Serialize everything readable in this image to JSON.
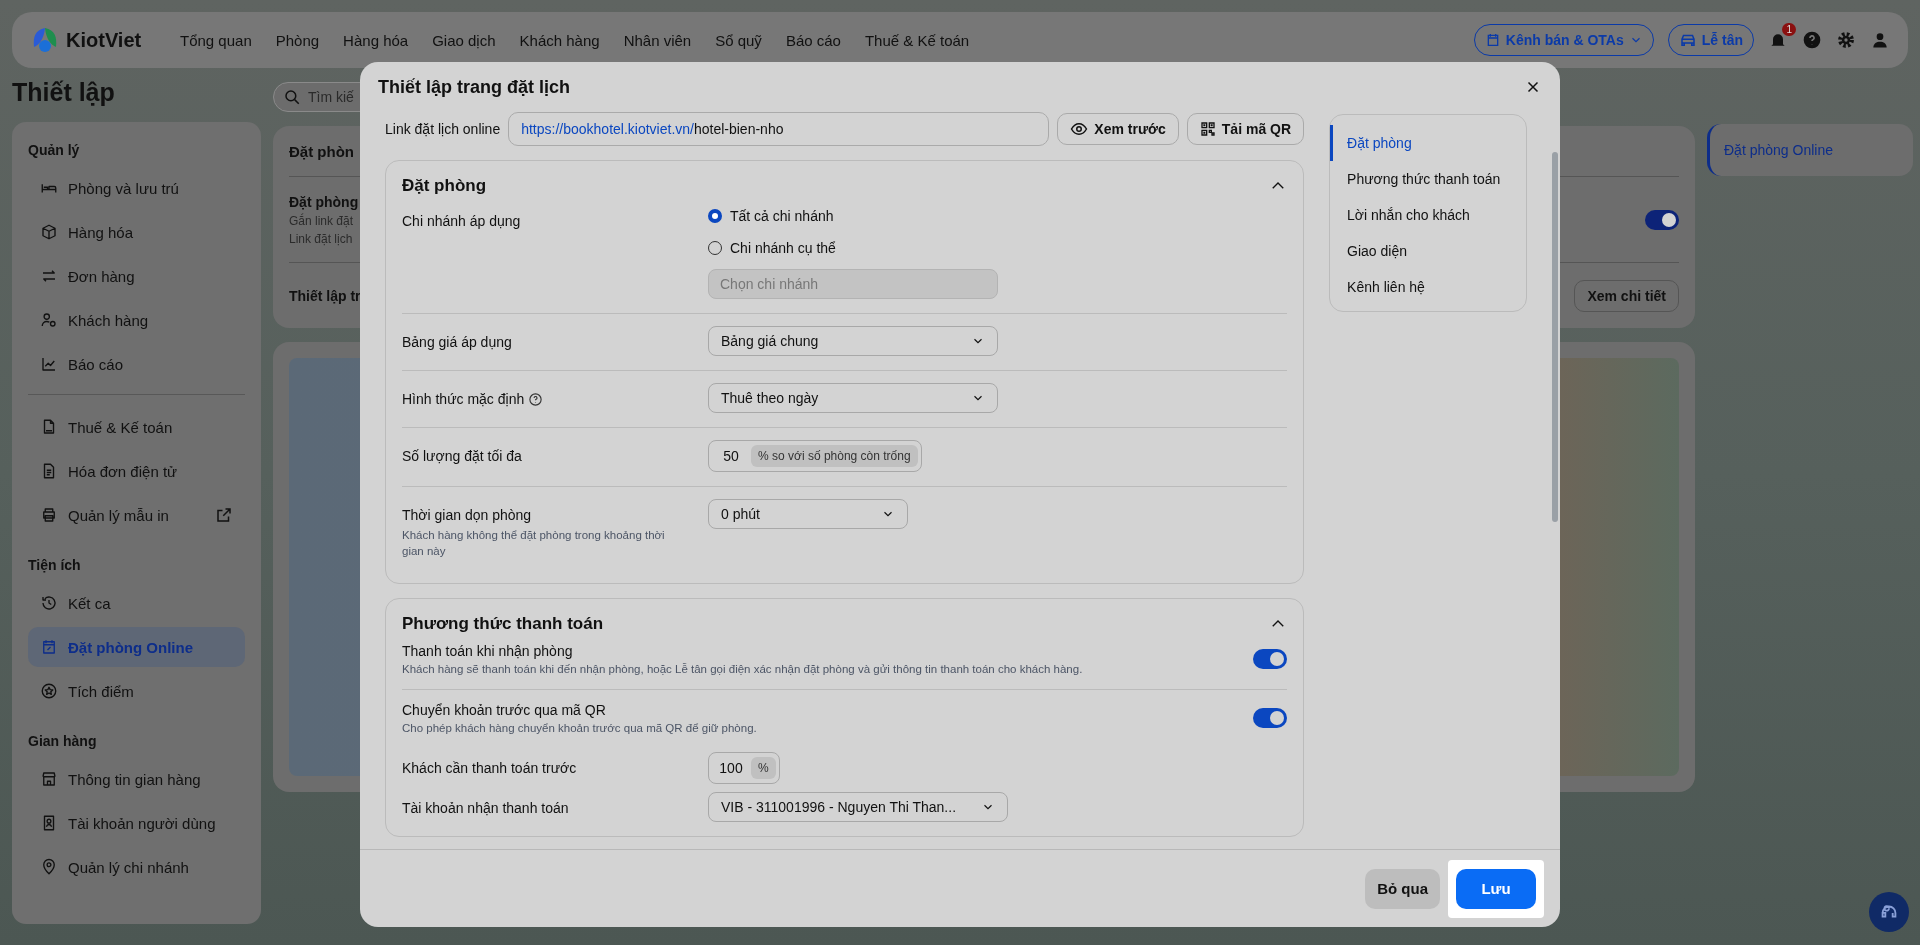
{
  "nav": {
    "brand": "KiotViet",
    "items": [
      "Tổng quan",
      "Phòng",
      "Hàng hóa",
      "Giao dịch",
      "Khách hàng",
      "Nhân viên",
      "Sổ quỹ",
      "Báo cáo",
      "Thuế & Kế toán"
    ],
    "channel_button": "Kênh bán & OTAs",
    "reception_button": "Lễ tân",
    "notification_count": "1"
  },
  "page_title": "Thiết lập",
  "search": {
    "placeholder": "Tìm kiế"
  },
  "sidebar": {
    "sections": [
      {
        "title": "Quản lý",
        "items": [
          {
            "label": "Phòng và lưu trú",
            "selected": false
          },
          {
            "label": "Hàng hóa",
            "selected": false
          },
          {
            "label": "Đơn hàng",
            "selected": false
          },
          {
            "label": "Khách hàng",
            "selected": false
          },
          {
            "label": "Báo cáo",
            "selected": false
          }
        ]
      },
      {
        "items": [
          {
            "label": "Thuế & Kế toán",
            "selected": false
          },
          {
            "label": "Hóa đơn điện tử",
            "selected": false
          },
          {
            "label": "Quản lý mẫu in",
            "selected": false,
            "external": true
          }
        ]
      },
      {
        "title": "Tiện ích",
        "items": [
          {
            "label": "Kết ca",
            "selected": false
          },
          {
            "label": "Đặt phòng Online",
            "selected": true
          },
          {
            "label": "Tích điểm",
            "selected": false
          }
        ]
      },
      {
        "title": "Gian hàng",
        "items": [
          {
            "label": "Thông tin gian hàng",
            "selected": false
          },
          {
            "label": "Tài khoản người dùng",
            "selected": false
          },
          {
            "label": "Quản lý chi nhánh",
            "selected": false
          }
        ]
      }
    ]
  },
  "settings_card": {
    "title": "Đặt phòn",
    "row_title": "Đặt phòng",
    "row_lines": [
      "Gắn link đặt",
      "Link đặt lịch"
    ],
    "on": true,
    "footer_title": "Thiết lập tr",
    "detail_button": "Xem chi tiết"
  },
  "right_nav": {
    "items": [
      {
        "label": "Đặt phòng Online",
        "selected": true
      }
    ]
  },
  "modal": {
    "title": "Thiết lập trang đặt lịch",
    "link": {
      "label": "Link đặt lịch online",
      "base": "https://bookhotel.kiotviet.vn/",
      "path": "hotel-bien-nho"
    },
    "preview_button": "Xem trước",
    "qr_button": "Tải mã QR",
    "sections": [
      {
        "title": "Đặt phòng",
        "expanded": true,
        "rows": [
          {
            "kind": "radio",
            "label": "Chi nhánh áp dụng",
            "options": [
              {
                "label": "Tất cả chi nhánh",
                "selected": true
              },
              {
                "label": "Chi nhánh cụ thể",
                "selected": false
              }
            ],
            "placeholder": "Chọn chi nhánh"
          },
          {
            "kind": "select",
            "label": "Bảng giá áp dụng",
            "value": "Bảng giá chung"
          },
          {
            "kind": "select",
            "label": "Hình thức mặc định",
            "help": true,
            "value": "Thuê theo ngày"
          },
          {
            "kind": "number",
            "label": "Số lượng đặt tối đa",
            "value": "50",
            "suffix": "% so với số phòng còn trống"
          },
          {
            "kind": "select",
            "label": "Thời gian dọn phòng",
            "description": "Khách hàng không thể đặt phòng trong khoảng thời gian này",
            "value": "0 phút"
          }
        ]
      },
      {
        "title": "Phương thức thanh toán",
        "expanded": true,
        "rows": [
          {
            "kind": "toggle",
            "label": "Thanh toán khi nhận phòng",
            "description": "Khách hàng sẽ thanh toán khi đến nhận phòng, hoặc Lễ tân gọi điện xác nhận đặt phòng và gửi thông tin thanh toán cho khách hàng.",
            "on": true
          },
          {
            "kind": "toggle",
            "label": "Chuyển khoản trước qua mã QR",
            "description": "Cho phép khách hàng chuyển khoản trước qua mã QR để giữ phòng.",
            "on": true
          },
          {
            "kind": "number",
            "label": "Khách cần thanh toán trước",
            "value": "100",
            "suffix": "%"
          },
          {
            "kind": "select",
            "label": "Tài khoản nhận thanh toán",
            "value": "VIB - 311001996 - Nguyen Thi Than...",
            "wide": true
          }
        ]
      }
    ],
    "nav": [
      {
        "label": "Đặt phòng",
        "selected": true
      },
      {
        "label": "Phương thức thanh toán",
        "selected": false
      },
      {
        "label": "Lời nhắn cho khách",
        "selected": false
      },
      {
        "label": "Giao diện",
        "selected": false
      },
      {
        "label": "Kênh liên hệ",
        "selected": false
      }
    ],
    "cancel_button": "Bỏ qua",
    "save_button": "Lưu"
  }
}
